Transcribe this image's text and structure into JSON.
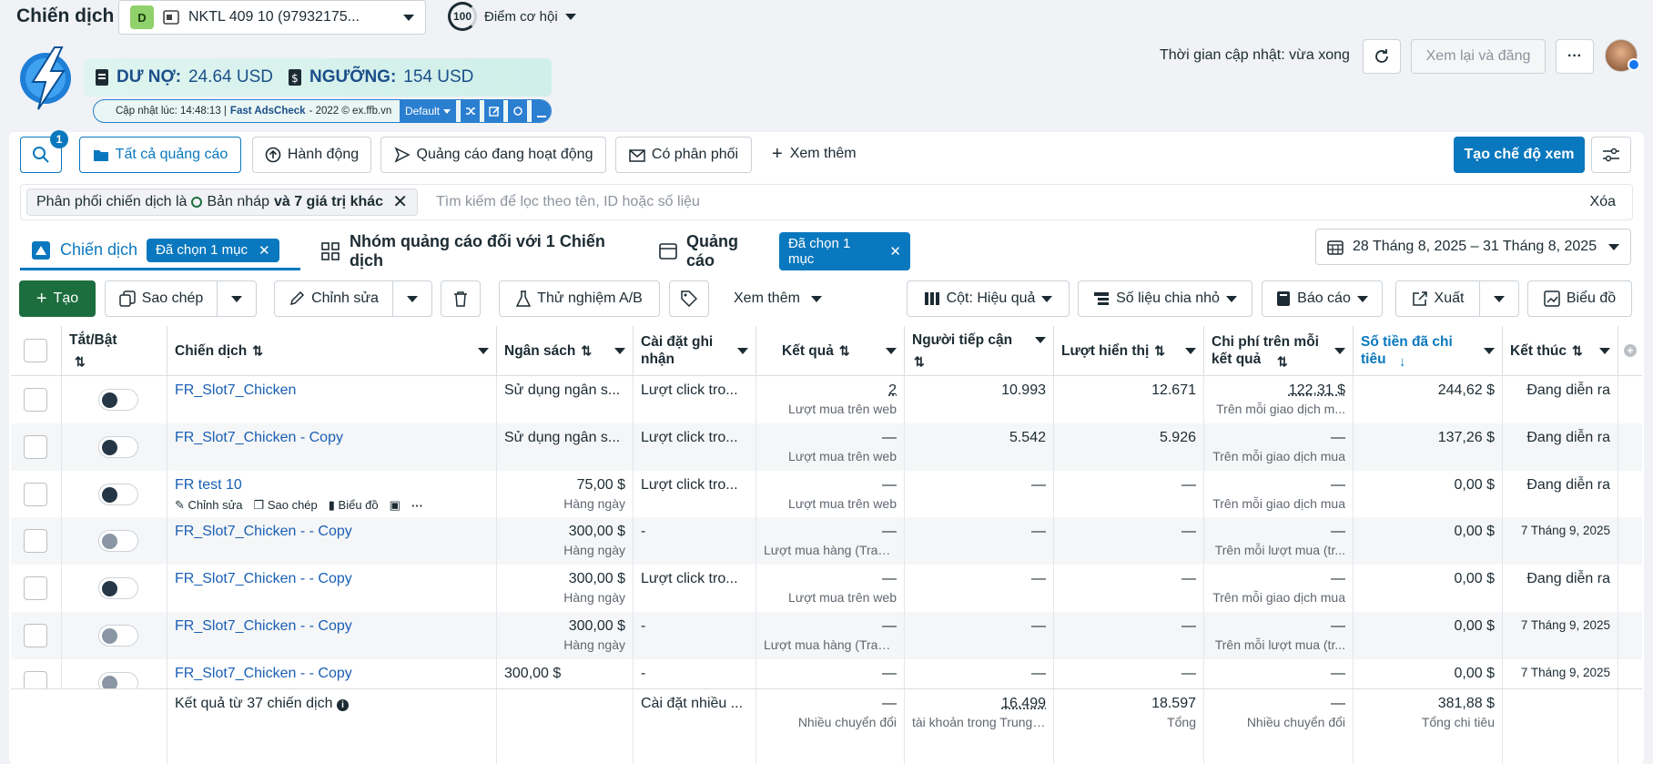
{
  "header": {
    "title": "Chiến dịch",
    "account_badge": "D",
    "account_name": "NKTL 409 10 (97932175...",
    "score": "100",
    "score_label": "Điểm cơ hội",
    "update_time": "Thời gian cập nhật: vừa xong",
    "review_btn": "Xem lại và đăng",
    "more": "···"
  },
  "ext": {
    "debt_label": "DƯ NỢ:",
    "debt_value": "24.64 USD",
    "threshold_label": "NGƯỠNG:",
    "threshold_value": "154 USD",
    "updated_prefix": "Cập nhật lúc: 14:48:13 |",
    "brand": "Fast AdsCheck",
    "credit": "- 2022 © ex.ffb.vn",
    "mode": "Default"
  },
  "toolbar": {
    "search_badge": "1",
    "tabs": [
      "Tất cả quảng cáo",
      "Hành động",
      "Quảng cáo đang hoạt động",
      "Có phân phối"
    ],
    "more": "Xem thêm",
    "create_view": "Tạo chế độ xem"
  },
  "filter": {
    "chip_prefix": "Phân phối chiến dịch là",
    "chip_value": "Bản nháp",
    "chip_suffix": "và 7 giá trị khác",
    "placeholder": "Tìm kiếm để lọc theo tên, ID hoặc số liệu",
    "clear": "Xóa"
  },
  "levels": {
    "campaign": "Chiến dịch",
    "campaign_sel": "Đã chọn 1 mục",
    "adset": "Nhóm quảng cáo đối với 1 Chiến dịch",
    "ad": "Quảng cáo",
    "ad_sel": "Đã chọn 1 mục",
    "date_range": "28 Tháng 8, 2025 – 31 Tháng 8, 2025"
  },
  "actions": {
    "create": "Tạo",
    "copy": "Sao chép",
    "edit": "Chỉnh sửa",
    "ab": "Thử nghiệm A/B",
    "more": "Xem thêm",
    "columns": "Cột: Hiệu quả",
    "breakdown": "Số liệu chia nhỏ",
    "report": "Báo cáo",
    "export": "Xuất",
    "chart": "Biểu đồ"
  },
  "columns": {
    "toggle": "Tắt/Bật",
    "campaign": "Chiến dịch",
    "budget": "Ngân sách",
    "attribution": "Cài đặt ghi nhận",
    "results": "Kết quả",
    "reach": "Người tiếp cận",
    "impressions": "Lượt hiển thị",
    "cpr": "Chi phí trên mỗi kết quả",
    "spent": "Số tiền đã chi tiêu",
    "end": "Kết thúc"
  },
  "hover": {
    "edit": "Chỉnh sửa",
    "copy": "Sao chép",
    "chart": "Biểu đồ"
  },
  "rows": [
    {
      "name": "FR_Slot7_Chicken",
      "on": true,
      "budget": "Sử dụng ngân s...",
      "budget_sub": "",
      "attr": "Lượt click tro...",
      "result": "2",
      "result_sub": "Lượt mua trên web",
      "reach": "10.993",
      "impr": "12.671",
      "cpr": "122,31 $",
      "cpr_sub": "Trên mỗi giao dịch m...",
      "spent": "244,62 $",
      "end": "Đang diễn ra"
    },
    {
      "name": "FR_Slot7_Chicken - Copy",
      "on": true,
      "budget": "Sử dụng ngân s...",
      "budget_sub": "",
      "attr": "Lượt click tro...",
      "result": "—",
      "result_sub": "Lượt mua trên web",
      "reach": "5.542",
      "impr": "5.926",
      "cpr": "—",
      "cpr_sub": "Trên mỗi giao dịch mua",
      "spent": "137,26 $",
      "end": "Đang diễn ra"
    },
    {
      "name": "FR test 10",
      "on": true,
      "budget": "75,00 $",
      "budget_sub": "Hàng ngày",
      "attr": "Lượt click tro...",
      "result": "—",
      "result_sub": "Lượt mua trên web",
      "reach": "—",
      "impr": "—",
      "cpr": "—",
      "cpr_sub": "Trên mỗi giao dịch mua",
      "spent": "0,00 $",
      "end": "Đang diễn ra"
    },
    {
      "name": "FR_Slot7_Chicken - - Copy",
      "on": false,
      "budget": "300,00 $",
      "budget_sub": "Hàng ngày",
      "attr": "-",
      "result": "—",
      "result_sub": "Lượt mua hàng (Trang...",
      "reach": "—",
      "impr": "—",
      "cpr": "—",
      "cpr_sub": "Trên mỗi lượt mua (tr...",
      "spent": "0,00 $",
      "end": "7 Tháng 9, 2025"
    },
    {
      "name": "FR_Slot7_Chicken - - Copy",
      "on": true,
      "budget": "300,00 $",
      "budget_sub": "Hàng ngày",
      "attr": "Lượt click tro...",
      "result": "—",
      "result_sub": "Lượt mua trên web",
      "reach": "—",
      "impr": "—",
      "cpr": "—",
      "cpr_sub": "Trên mỗi giao dịch mua",
      "spent": "0,00 $",
      "end": "Đang diễn ra"
    },
    {
      "name": "FR_Slot7_Chicken - - Copy",
      "on": false,
      "budget": "300,00 $",
      "budget_sub": "Hàng ngày",
      "attr": "-",
      "result": "—",
      "result_sub": "Lượt mua hàng (Trang...",
      "reach": "—",
      "impr": "—",
      "cpr": "—",
      "cpr_sub": "Trên mỗi lượt mua (tr...",
      "spent": "0,00 $",
      "end": "7 Tháng 9, 2025"
    },
    {
      "name": "FR_Slot7_Chicken - - Copy",
      "on": false,
      "budget": "300,00 $",
      "budget_sub": "",
      "attr": "-",
      "result": "—",
      "result_sub": "",
      "reach": "—",
      "impr": "—",
      "cpr": "—",
      "cpr_sub": "",
      "spent": "0,00 $",
      "end": "7 Tháng 9, 2025"
    }
  ],
  "footer": {
    "label": "Kết quả từ 37 chiến dịch",
    "attr": "Cài đặt nhiều ...",
    "result": "—",
    "result_sub": "Nhiều chuyển đổi",
    "reach": "16.499",
    "reach_sub": "tài khoản trong Trung ...",
    "impr": "18.597",
    "impr_sub": "Tổng",
    "cpr": "—",
    "cpr_sub": "Nhiều chuyển đổi",
    "spent": "381,88 $",
    "spent_sub": "Tổng chi tiêu"
  },
  "colors": {
    "primary": "#0a78be",
    "green": "#1d6e3f",
    "link": "#1a5fb4"
  }
}
